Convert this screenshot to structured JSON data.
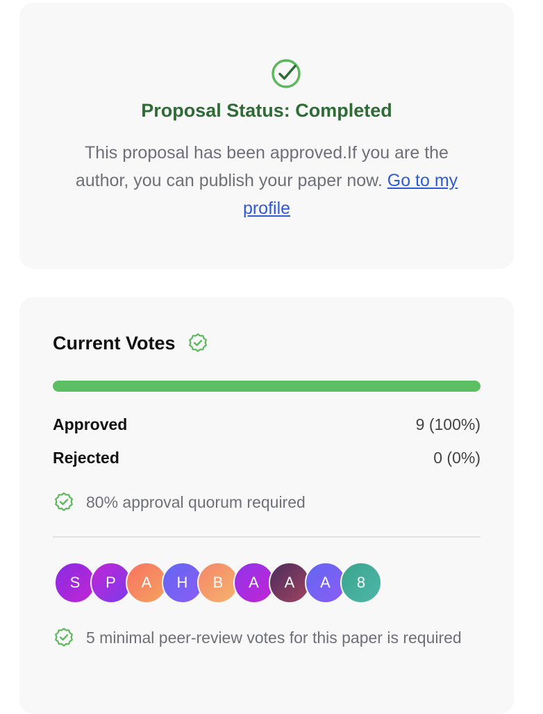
{
  "status": {
    "title": "Proposal Status: Completed",
    "description": "This proposal has been approved.If you are the author, you can publish your paper now.",
    "link_label": "Go to my profile",
    "icon": "check-circle-icon",
    "color": "#2e6b35"
  },
  "votes": {
    "title": "Current Votes",
    "title_icon": "verified-badge-icon",
    "progress_fraction": 1.0,
    "progress_color": "#5cbf63",
    "approved_label": "Approved",
    "approved_value": "9 (100%)",
    "rejected_label": "Rejected",
    "rejected_value": "0 (0%)",
    "quorum_text": "80% approval quorum required",
    "peer_review_text": "5 minimal peer-review votes for this paper is required",
    "avatars": [
      {
        "letter": "S",
        "gradient": [
          "#8a2be2",
          "#c026d3"
        ]
      },
      {
        "letter": "P",
        "gradient": [
          "#c026d3",
          "#7c3aed"
        ]
      },
      {
        "letter": "A",
        "gradient": [
          "#f97362",
          "#f4a261"
        ]
      },
      {
        "letter": "H",
        "gradient": [
          "#6366f1",
          "#8b5cf6"
        ]
      },
      {
        "letter": "B",
        "gradient": [
          "#f4876b",
          "#f6b26b"
        ]
      },
      {
        "letter": "A",
        "gradient": [
          "#9333ea",
          "#c026d3"
        ]
      },
      {
        "letter": "A",
        "gradient": [
          "#4a2c5e",
          "#a1445f"
        ]
      },
      {
        "letter": "A",
        "gradient": [
          "#6366f1",
          "#8b5cf6"
        ]
      },
      {
        "letter": "8",
        "gradient": [
          "#3ba58e",
          "#4fb6a8"
        ]
      }
    ]
  }
}
